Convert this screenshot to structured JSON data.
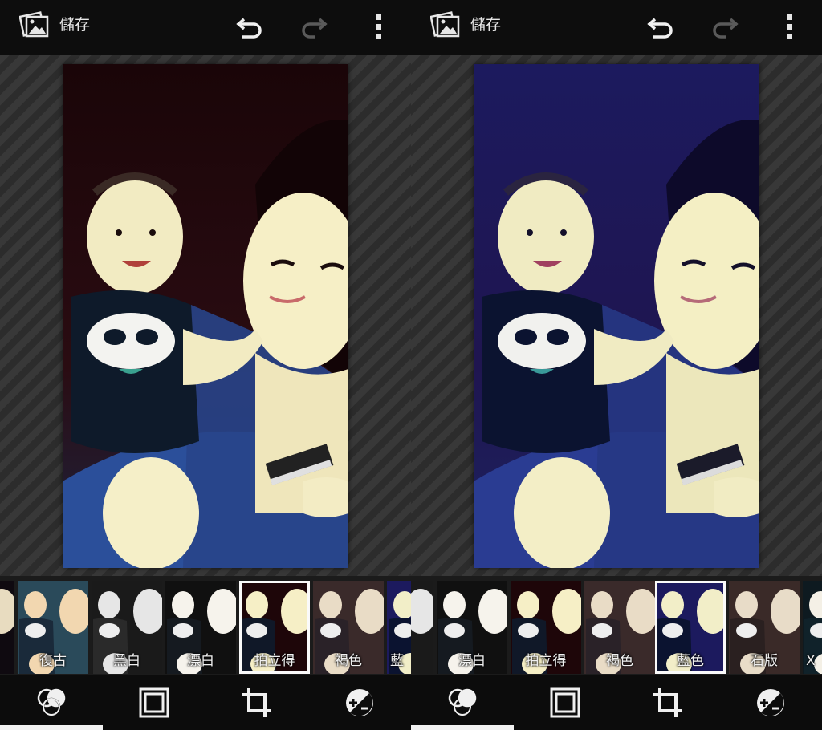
{
  "screens": [
    {
      "id": "left",
      "topbar": {
        "save_label": "儲存"
      },
      "photo_tint": "warm",
      "filters": [
        {
          "label": "",
          "tint": "dark"
        },
        {
          "label": "復古",
          "tint": "vintage"
        },
        {
          "label": "黑白",
          "tint": "bw"
        },
        {
          "label": "漂白",
          "tint": "bleach"
        },
        {
          "label": "拍立得",
          "tint": "warm",
          "selected": true
        },
        {
          "label": "褐色",
          "tint": "sepia"
        },
        {
          "label": "藍",
          "tint": "blue"
        }
      ]
    },
    {
      "id": "right",
      "topbar": {
        "save_label": "儲存"
      },
      "photo_tint": "blue",
      "filters": [
        {
          "label": "",
          "tint": "bw"
        },
        {
          "label": "漂白",
          "tint": "bleach"
        },
        {
          "label": "拍立得",
          "tint": "warm"
        },
        {
          "label": "褐色",
          "tint": "sepia"
        },
        {
          "label": "藍色",
          "tint": "blue",
          "selected": true
        },
        {
          "label": "石版",
          "tint": "lith"
        },
        {
          "label": "X",
          "tint": "xpro"
        }
      ]
    }
  ],
  "icons": {
    "gallery": "gallery-icon",
    "undo": "undo-icon",
    "redo": "redo-icon",
    "more": "more-vert-icon",
    "filters": "filters-icon",
    "frame": "frame-icon",
    "crop": "crop-icon",
    "exposure": "exposure-icon"
  },
  "colors": {
    "topbar_bg": "#0d0d0d",
    "strip_bg": "#1b1b1b",
    "toolbar_bg": "#0c0c0c",
    "active": "#f2f2f2",
    "redo_disabled": "#5a5a5a"
  }
}
